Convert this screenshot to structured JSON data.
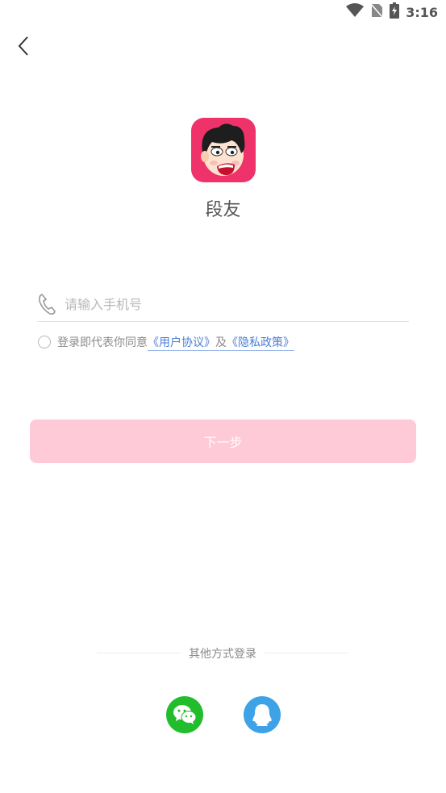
{
  "status_bar": {
    "time": "3:16"
  },
  "app": {
    "name": "段友"
  },
  "login": {
    "phone_placeholder": "请输入手机号",
    "phone_value": "",
    "agree_text": "登录即代表你同意",
    "user_agreement": "《用户协议》",
    "and_text": "及",
    "privacy_policy": "《隐私政策》",
    "next_label": "下一步"
  },
  "other_login": {
    "label": "其他方式登录",
    "options": [
      {
        "name": "wechat-icon",
        "color": "#21bd2c"
      },
      {
        "name": "qq-icon",
        "color": "#3ea2e6"
      }
    ]
  },
  "colors": {
    "brand": "#f0326a",
    "button_disabled": "#ffcad7",
    "link": "#4a7fd6"
  }
}
